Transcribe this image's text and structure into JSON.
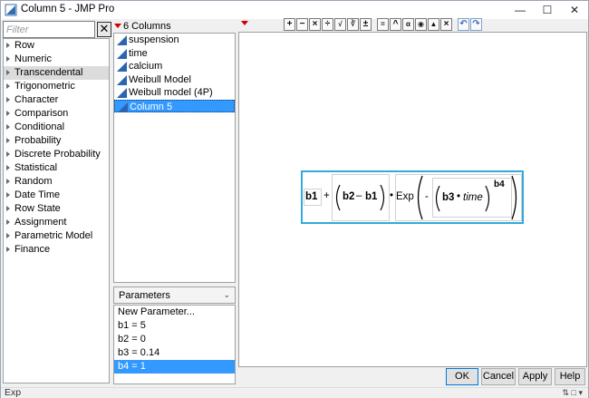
{
  "window": {
    "title": "Column 5 - JMP Pro"
  },
  "function_panel": {
    "filter_placeholder": "Filter",
    "items": [
      {
        "label": "Row"
      },
      {
        "label": "Numeric"
      },
      {
        "label": "Transcendental"
      },
      {
        "label": "Trigonometric"
      },
      {
        "label": "Character"
      },
      {
        "label": "Comparison"
      },
      {
        "label": "Conditional"
      },
      {
        "label": "Probability"
      },
      {
        "label": "Discrete Probability"
      },
      {
        "label": "Statistical"
      },
      {
        "label": "Random"
      },
      {
        "label": "Date Time"
      },
      {
        "label": "Row State"
      },
      {
        "label": "Assignment"
      },
      {
        "label": "Parametric Model"
      },
      {
        "label": "Finance"
      }
    ]
  },
  "columns_panel": {
    "header": "6 Columns",
    "items": [
      {
        "label": "suspension"
      },
      {
        "label": "time"
      },
      {
        "label": "calcium"
      },
      {
        "label": "Weibull Model"
      },
      {
        "label": "Weibull model (4P)"
      },
      {
        "label": "Column 5"
      }
    ]
  },
  "parameters_panel": {
    "selector": "Parameters",
    "items": [
      {
        "label": "New Parameter..."
      },
      {
        "label": "b1 = 5"
      },
      {
        "label": "b2 = 0"
      },
      {
        "label": "b3 = 0.14"
      },
      {
        "label": "b4 = 1"
      }
    ]
  },
  "formula": {
    "b1": "b1",
    "plus": "+",
    "b2": "b2",
    "minus": "–",
    "b1b": "b1",
    "dot1": "•",
    "exp": "Exp",
    "neg": "-",
    "b3": "b3",
    "dot2": "•",
    "time": "time",
    "b4": "b4"
  },
  "toolbar": {
    "icons": [
      "plus",
      "minus",
      "times",
      "divide",
      "sqrt-x",
      "sqrt-n",
      "plus-minus",
      "assign",
      "power",
      "local",
      "peel",
      "extract",
      "delete",
      "undo",
      "redo"
    ]
  },
  "buttons": {
    "ok": "OK",
    "cancel": "Cancel",
    "apply": "Apply",
    "help": "Help"
  },
  "status": {
    "text": "Exp"
  },
  "colors": {
    "selection": "#3399ff",
    "formula_border": "#33aadd",
    "accent_red": "#cc0000"
  }
}
